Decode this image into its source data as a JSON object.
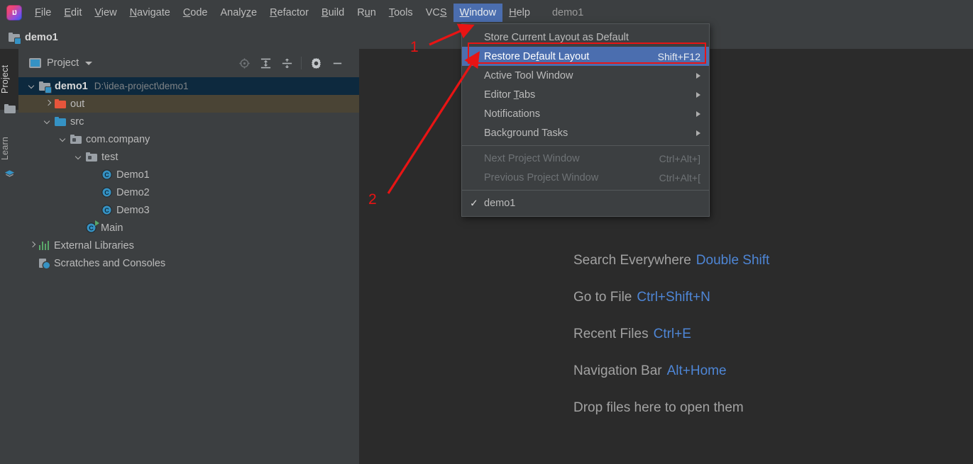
{
  "app": {
    "logo_icon": "intellij-idea-logo",
    "project_title": "demo1"
  },
  "menubar": {
    "items": [
      {
        "label": "File",
        "mnemonic": "F"
      },
      {
        "label": "Edit",
        "mnemonic": "E"
      },
      {
        "label": "View",
        "mnemonic": "V"
      },
      {
        "label": "Navigate",
        "mnemonic": "N"
      },
      {
        "label": "Code",
        "mnemonic": "C"
      },
      {
        "label": "Analyze",
        "mnemonic": "z"
      },
      {
        "label": "Refactor",
        "mnemonic": "R"
      },
      {
        "label": "Build",
        "mnemonic": "B"
      },
      {
        "label": "Run",
        "mnemonic": "u"
      },
      {
        "label": "Tools",
        "mnemonic": "T"
      },
      {
        "label": "VCS",
        "mnemonic": "S"
      },
      {
        "label": "Window",
        "mnemonic": "W",
        "active": true
      },
      {
        "label": "Help",
        "mnemonic": "H"
      }
    ],
    "trailing_label": "demo1"
  },
  "breadcrumb": {
    "icon": "project-folder-icon",
    "label": "demo1"
  },
  "stripe": {
    "tabs": [
      {
        "label": "Project",
        "selected": true,
        "icon": "project-tab-icon"
      },
      {
        "label": "Learn",
        "selected": false,
        "icon": "learn-tab-icon"
      }
    ]
  },
  "project_panel": {
    "header": {
      "icon": "project-view-icon",
      "title": "Project",
      "dropdown_icon": "chevron-down-icon",
      "tools": [
        {
          "name": "locate-icon",
          "label": "Select Opened File"
        },
        {
          "name": "expand-all-icon",
          "label": "Expand All"
        },
        {
          "name": "collapse-all-icon",
          "label": "Collapse All"
        },
        {
          "name": "settings-gear-icon",
          "label": "Options"
        },
        {
          "name": "hide-icon",
          "label": "Hide"
        }
      ]
    },
    "tree": [
      {
        "label": "demo1",
        "path": "D:\\idea-project\\demo1",
        "indent": 0,
        "arrow": "down",
        "icon": "project-folder-icon",
        "state": "selected",
        "bold": true
      },
      {
        "label": "out",
        "path": "",
        "indent": 1,
        "arrow": "right",
        "icon": "folder-orange-icon",
        "state": "hovered",
        "bold": false
      },
      {
        "label": "src",
        "path": "",
        "indent": 1,
        "arrow": "down",
        "icon": "folder-blue-icon",
        "state": "normal",
        "bold": false
      },
      {
        "label": "com.company",
        "path": "",
        "indent": 2,
        "arrow": "down",
        "icon": "package-icon",
        "state": "normal",
        "bold": false
      },
      {
        "label": "test",
        "path": "",
        "indent": 3,
        "arrow": "down",
        "icon": "package-icon",
        "state": "normal",
        "bold": false
      },
      {
        "label": "Demo1",
        "path": "",
        "indent": 4,
        "arrow": "none",
        "icon": "java-class-icon",
        "state": "normal",
        "bold": false
      },
      {
        "label": "Demo2",
        "path": "",
        "indent": 4,
        "arrow": "none",
        "icon": "java-class-icon",
        "state": "normal",
        "bold": false
      },
      {
        "label": "Demo3",
        "path": "",
        "indent": 4,
        "arrow": "none",
        "icon": "java-class-icon",
        "state": "normal",
        "bold": false
      },
      {
        "label": "Main",
        "path": "",
        "indent": 3,
        "arrow": "none",
        "icon": "java-main-class-icon",
        "state": "normal",
        "bold": false
      },
      {
        "label": "External Libraries",
        "path": "",
        "indent": 0,
        "arrow": "right",
        "icon": "libraries-icon",
        "state": "normal",
        "bold": false
      },
      {
        "label": "Scratches and Consoles",
        "path": "",
        "indent": 0,
        "arrow": "none",
        "icon": "scratches-icon",
        "state": "normal",
        "bold": false
      }
    ]
  },
  "window_menu": {
    "items": [
      {
        "label": "Store Current Layout as Default",
        "shortcut": "",
        "type": "item",
        "state": "normal",
        "submenu": false,
        "checked": false
      },
      {
        "label": "Restore Default Layout",
        "shortcut": "Shift+F12",
        "type": "item",
        "state": "selected",
        "submenu": false,
        "checked": false,
        "mnemonic": "f"
      },
      {
        "label": "Active Tool Window",
        "shortcut": "",
        "type": "item",
        "state": "normal",
        "submenu": true,
        "checked": false
      },
      {
        "label": "Editor Tabs",
        "shortcut": "",
        "type": "item",
        "state": "normal",
        "submenu": true,
        "checked": false,
        "mnemonic": "T"
      },
      {
        "label": "Notifications",
        "shortcut": "",
        "type": "item",
        "state": "normal",
        "submenu": true,
        "checked": false
      },
      {
        "label": "Background Tasks",
        "shortcut": "",
        "type": "item",
        "state": "normal",
        "submenu": true,
        "checked": false
      },
      {
        "label": "",
        "shortcut": "",
        "type": "separator",
        "state": "normal",
        "submenu": false,
        "checked": false
      },
      {
        "label": "Next Project Window",
        "shortcut": "Ctrl+Alt+]",
        "type": "item",
        "state": "disabled",
        "submenu": false,
        "checked": false
      },
      {
        "label": "Previous Project Window",
        "shortcut": "Ctrl+Alt+[",
        "type": "item",
        "state": "disabled",
        "submenu": false,
        "checked": false
      },
      {
        "label": "",
        "shortcut": "",
        "type": "separator",
        "state": "normal",
        "submenu": false,
        "checked": false
      },
      {
        "label": "demo1",
        "shortcut": "",
        "type": "item",
        "state": "normal",
        "submenu": false,
        "checked": true
      }
    ]
  },
  "editor": {
    "hints": [
      {
        "action": "Search Everywhere",
        "shortcut": "Double Shift"
      },
      {
        "action": "Go to File",
        "shortcut": "Ctrl+Shift+N"
      },
      {
        "action": "Recent Files",
        "shortcut": "Ctrl+E"
      },
      {
        "action": "Navigation Bar",
        "shortcut": "Alt+Home"
      },
      {
        "action": "Drop files here to open them",
        "shortcut": ""
      }
    ]
  },
  "annotations": {
    "color": "#e81414",
    "markers": [
      {
        "number": "1",
        "target": "window-menu-title"
      },
      {
        "number": "2",
        "target": "restore-default-layout-item"
      }
    ]
  },
  "colors": {
    "panel_bg": "#3c3f41",
    "editor_bg": "#2b2b2b",
    "selection_blue": "#4b6eaf",
    "tree_selected": "#0d293e",
    "tree_hover": "#4a4435",
    "accent_link": "#4e86d6",
    "annotation_red": "#e81414"
  }
}
